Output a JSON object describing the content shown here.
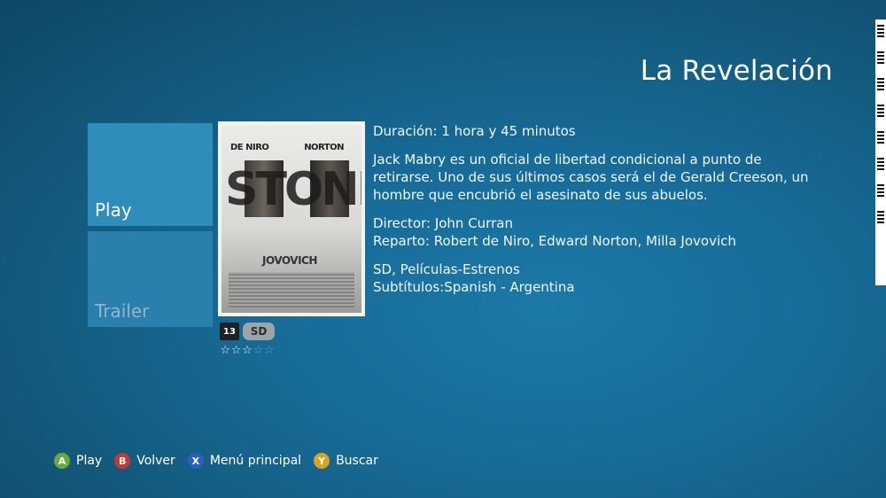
{
  "header": {
    "title": "La Revelación"
  },
  "tiles": {
    "play_label": "Play",
    "trailer_label": "Trailer"
  },
  "poster": {
    "actor1": "DE NIRO",
    "actor2": "NORTON",
    "movie_title": "STONE",
    "actor3": "JOVOVICH"
  },
  "badges": {
    "rating": "13",
    "quality": "SD"
  },
  "stars": {
    "filled": 3,
    "total": 5
  },
  "info": {
    "duration": "Duración: 1 hora y 45 minutos",
    "synopsis": "Jack Mabry es un oficial de libertad condicional a punto de retirarse. Uno de sus últimos casos será el de Gerald Creeson, un hombre que encubrió el asesinato de sus abuelos.",
    "director": "Director: John Curran",
    "cast": "Reparto: Robert de Niro, Edward Norton, Milla Jovovich",
    "category": "SD, Películas-Estrenos",
    "subtitles": "Subtítulos:Spanish - Argentina"
  },
  "footer": {
    "hints": [
      {
        "button": "A",
        "label": "Play"
      },
      {
        "button": "B",
        "label": "Volver"
      },
      {
        "button": "X",
        "label": "Menú principal"
      },
      {
        "button": "Y",
        "label": "Buscar"
      }
    ]
  },
  "colors": {
    "tile_play": "#2f8dbb",
    "tile_trailer": "#2a80ad",
    "button_a": "#6aaa3a",
    "button_b": "#c43a33",
    "button_x": "#2b5fb8",
    "button_y": "#d9a422"
  }
}
